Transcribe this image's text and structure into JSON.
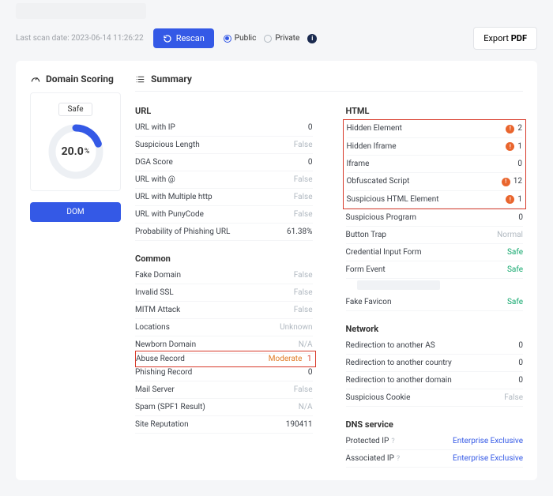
{
  "header": {
    "last_scan_prefix": "Last scan date:",
    "last_scan_date": "2023-06-14 11:26:22",
    "rescan": "Rescan",
    "public": "Public",
    "private": "Private",
    "export_prefix": "Export",
    "export_fmt": "PDF"
  },
  "sidebar": {
    "title": "Domain Scoring",
    "safe": "Safe",
    "score": "20.0",
    "score_unit": "%",
    "dom": "DOM"
  },
  "summary": {
    "title": "Summary"
  },
  "sections": {
    "url": {
      "title": "URL",
      "rows": [
        {
          "k": "URL with IP",
          "v": "0"
        },
        {
          "k": "Suspicious Length",
          "v": "False",
          "m": true
        },
        {
          "k": "DGA Score",
          "v": "0"
        },
        {
          "k": "URL with @",
          "v": "False",
          "m": true
        },
        {
          "k": "URL with Multiple http",
          "v": "False",
          "m": true
        },
        {
          "k": "URL with PunyCode",
          "v": "False",
          "m": true
        },
        {
          "k": "Probability of Phishing URL",
          "v": "61.38%"
        }
      ]
    },
    "common": {
      "title": "Common",
      "rows": [
        {
          "k": "Fake Domain",
          "v": "False",
          "m": true
        },
        {
          "k": "Invalid SSL",
          "v": "False",
          "m": true
        },
        {
          "k": "MITM Attack",
          "v": "False",
          "m": true
        },
        {
          "k": "Locations",
          "v": "Unknown",
          "m": true
        },
        {
          "k": "Newborn Domain",
          "v": "N/A",
          "m": true
        },
        {
          "k": "Abuse Record",
          "v": "Moderate",
          "warn": true,
          "badge": "1",
          "hl": true
        },
        {
          "k": "Phishing Record",
          "v": "0"
        },
        {
          "k": "Mail Server",
          "v": "False",
          "m": true
        },
        {
          "k": "Spam (SPF1 Result)",
          "v": "N/A",
          "m": true
        },
        {
          "k": "Site Reputation",
          "v": "190411"
        }
      ]
    },
    "html": {
      "title": "HTML",
      "rows": [
        {
          "k": "Hidden Element",
          "alert": true,
          "v": "2",
          "grp": true
        },
        {
          "k": "Hidden Iframe",
          "alert": true,
          "v": "1",
          "grp": true
        },
        {
          "k": "Iframe",
          "v": "0",
          "grp": true
        },
        {
          "k": "Obfuscated Script",
          "alert": true,
          "v": "12",
          "grp": true
        },
        {
          "k": "Suspicious HTML Element",
          "alert": true,
          "v": "1",
          "grp": true
        },
        {
          "k": "Suspicious Program",
          "v": "0"
        },
        {
          "k": "Button Trap",
          "v": "Normal",
          "m": true
        },
        {
          "k": "Credential Input Form",
          "v": "Safe",
          "ok": true
        },
        {
          "k": "Form Event",
          "v": "Safe",
          "ok": true,
          "subbar": true
        },
        {
          "k": "Fake Favicon",
          "v": "Safe",
          "ok": true
        }
      ]
    },
    "network": {
      "title": "Network",
      "rows": [
        {
          "k": "Redirection to another AS",
          "v": "0"
        },
        {
          "k": "Redirection to another country",
          "v": "0"
        },
        {
          "k": "Redirection to another domain",
          "v": "0"
        },
        {
          "k": "Suspicious Cookie",
          "v": "False",
          "m": true
        }
      ]
    },
    "dns": {
      "title": "DNS service",
      "rows": [
        {
          "k": "Protected IP",
          "help": true,
          "v": "Enterprise Exclusive",
          "link": true
        },
        {
          "k": "Associated IP",
          "help": true,
          "v": "Enterprise Exclusive",
          "link": true
        }
      ]
    }
  }
}
